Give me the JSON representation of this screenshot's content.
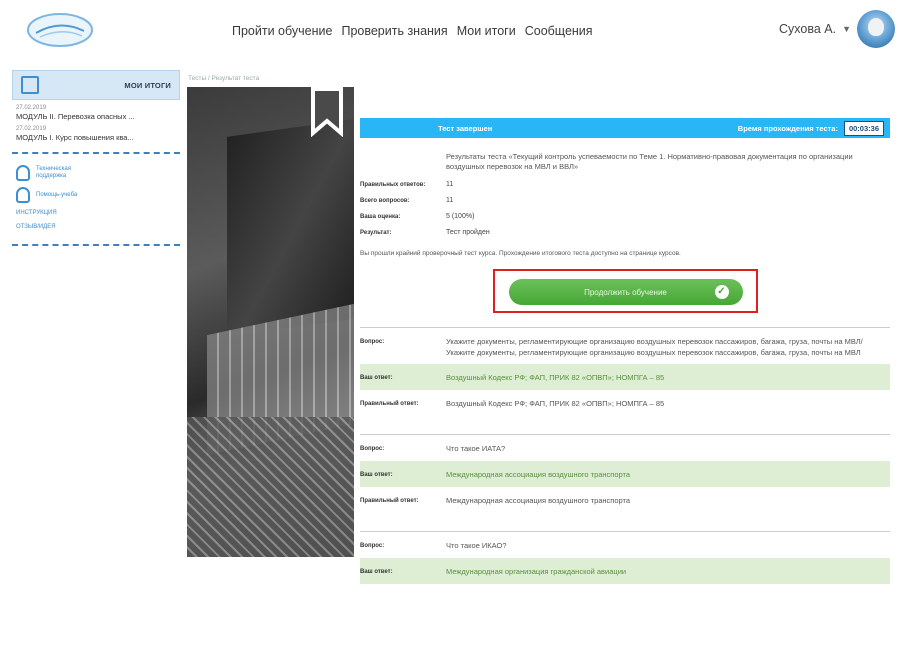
{
  "header": {
    "nav": [
      "Пройти обучение",
      "Проверить знания",
      "Мои итоги",
      "Сообщения"
    ],
    "user_name": "Сухова А."
  },
  "sidebar": {
    "title": "МОИ ИТОГИ",
    "items": [
      {
        "date": "27.02.2019",
        "name": "МОДУЛЬ II. Перевозка опасных ..."
      },
      {
        "date": "27.02.2019",
        "name": "МОДУЛЬ I. Курс повышения ква..."
      }
    ],
    "links": [
      "Техническая поддержка",
      "Помощь-учеба"
    ],
    "small_links": [
      "ИНСТРУКЦИЯ",
      "ОТЗЫВ/ИДЕЯ"
    ]
  },
  "breadcrumb": "Тесты / Результат теста",
  "result": {
    "banner_left": "Тест завершен",
    "banner_time_label": "Время прохождения теста:",
    "time": "00:03:36",
    "description": "Результаты теста «Текущий контроль успеваемости по Теме 1. Нормативно-правовая документация по организации воздушных перевозок на МВЛ и ВВЛ»",
    "correct_label": "Правильных ответов:",
    "correct_value": "11",
    "total_label": "Всего вопросов:",
    "total_value": "11",
    "score_label": "Ваша оценка:",
    "score_value": "5 (100%)",
    "status_label": "Результат:",
    "status_value": "Тест пройден",
    "note": "Вы прошли крайний проверочный тест курса. Прохождение итогового теста доступно на странице курсов.",
    "continue_button": "Продолжить обучение"
  },
  "questions": [
    {
      "q_label": "Вопрос:",
      "question": "Укажите документы, регламентирующие организацию воздушных перевозок пассажиров, багажа, груза, почты на МВЛ/Укажите документы, регламентирующие организацию воздушных перевозок пассажиров, багажа, груза, почты на МВЛ",
      "your_label": "Ваш ответ:",
      "your_answer": "Воздушный Кодекс РФ; ФАП, ПРИК 82 «ОПВП»; НОМПГА – 85",
      "right_label": "Правильный ответ:",
      "right_answer": "Воздушный Кодекс РФ; ФАП, ПРИК 82 «ОПВП»; НОМПГА – 85"
    },
    {
      "q_label": "Вопрос:",
      "question": "Что такое ИАТА?",
      "your_label": "Ваш ответ:",
      "your_answer": "Международная ассоциация воздушного транспорта",
      "right_label": "Правильный ответ:",
      "right_answer": "Международная ассоциация воздушного транспорта"
    },
    {
      "q_label": "Вопрос:",
      "question": "Что такое ИКАО?",
      "your_label": "Ваш ответ:",
      "your_answer": "Международная организация гражданской авиации"
    }
  ]
}
